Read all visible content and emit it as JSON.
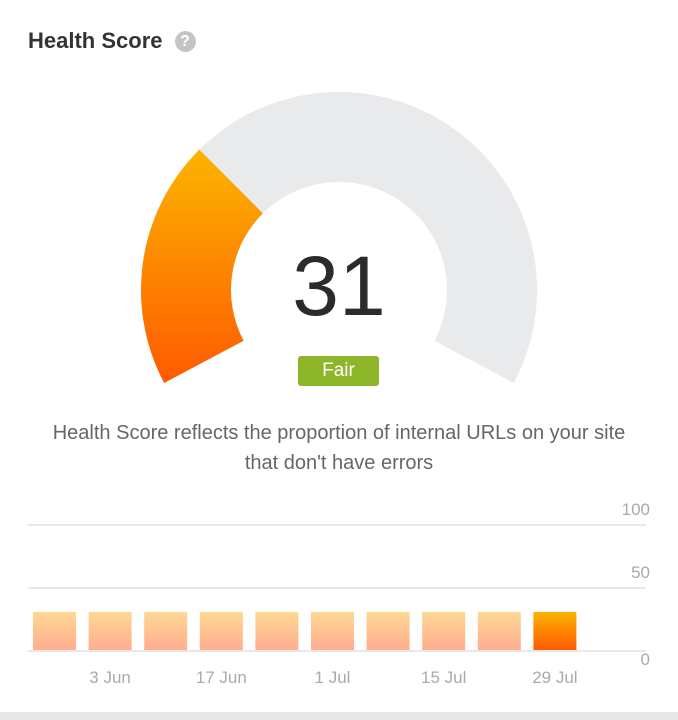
{
  "header": {
    "title": "Health Score",
    "help_icon": "question-circle-icon"
  },
  "gauge": {
    "score": 31,
    "score_label": "31",
    "rating": "Fair",
    "max": 100,
    "fill_color_top": "#fbb400",
    "fill_color_bottom": "#ff5a00",
    "track_color": "#e9eaec",
    "rating_color": "#8db62a"
  },
  "description": "Health Score reflects the proportion of internal URLs on your site that don't have errors",
  "chart_data": {
    "type": "bar",
    "categories": [
      "",
      "3 Jun",
      "",
      "17 Jun",
      "",
      "1 Jul",
      "",
      "15 Jul",
      "",
      "29 Jul"
    ],
    "x_tick_labels": [
      "3 Jun",
      "17 Jun",
      "1 Jul",
      "15 Jul",
      "29 Jul"
    ],
    "values": [
      31,
      31,
      31,
      31,
      31,
      31,
      31,
      31,
      31,
      31
    ],
    "ylim": [
      0,
      100
    ],
    "y_ticks": [
      "0",
      "50",
      "100"
    ],
    "grid": true,
    "highlight_last": true,
    "bar_color_top": "#fed893",
    "bar_color_bottom": "#ffad90",
    "highlight_color_top": "#fbb400",
    "highlight_color_bottom": "#ff5a00"
  }
}
